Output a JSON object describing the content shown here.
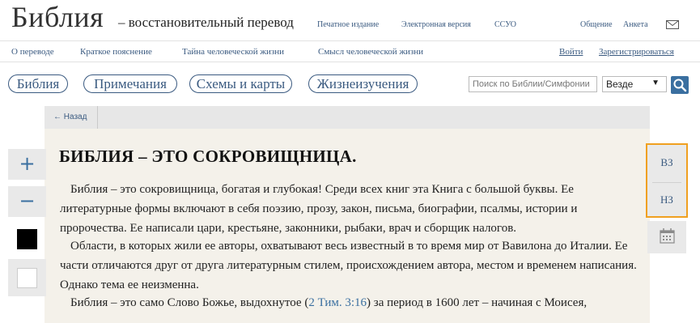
{
  "header": {
    "logo": "Библия",
    "tagline": "– восстановительный перевод",
    "links": [
      "Печатное издание",
      "Электронная версия",
      "ССУО"
    ],
    "right_links": [
      "Общение",
      "Анкета"
    ]
  },
  "nav": {
    "items": [
      "О переводе",
      "Краткое пояснение",
      "Тайна человеческой жизни",
      "Смысл человеческой жизни"
    ],
    "login": "Войти",
    "register": "Зарегистрироваться"
  },
  "tabs": [
    "Библия",
    "Примечания",
    "Схемы и карты",
    "Жизнеизучения"
  ],
  "search": {
    "placeholder": "Поиск по Библии/Симфонии",
    "scope": "Везде"
  },
  "back_label": "← Назад",
  "article": {
    "title": "БИБЛИЯ – ЭТО СОКРОВИЩНИЦА.",
    "p1": "Библия – это сокровищница, богатая и глубокая! Среди всех книг эта Книга с большой буквы. Ее литературные формы включают в себя поэзию, прозу, закон, письма, биографии, псалмы, истории и пророчества. Ее написали цари, крестьяне, законники, рыбаки, врач и сборщик налогов.",
    "p2": "Области, в которых жили ее авторы, охватывают весь известный в то время мир от Вавилона до Италии. Ее части отличаются друг от друга литературным стилем, происхождением автора, местом и временем написания. Однако тема ее неизменна.",
    "p3_before": "Библия – это само Слово Божье, выдохнутое (",
    "p3_ref": "2 Тим. 3:16",
    "p3_after": ") за период в 1600 лет – начиная с Моисея,"
  },
  "tools": {
    "increase": "+",
    "decrease": "−"
  },
  "testament": {
    "ot": "ВЗ",
    "nt": "НЗ"
  },
  "colors": {
    "accent": "#3a5a80",
    "highlight": "#f0a020",
    "content_bg": "#f4f1ea"
  }
}
